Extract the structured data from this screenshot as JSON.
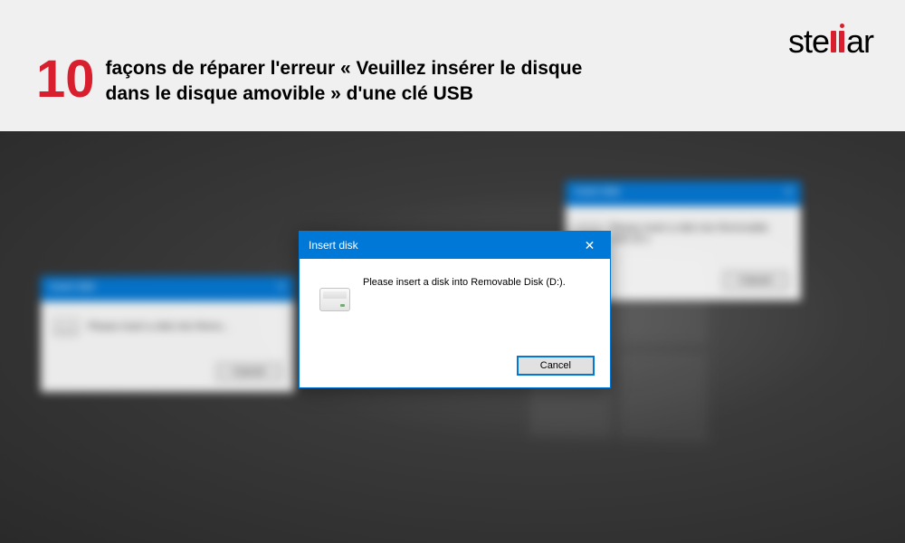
{
  "header": {
    "brand_pre": "ste",
    "brand_post": "ar",
    "number": "10",
    "title": "façons de réparer l'erreur « Veuillez insérer le disque dans le disque amovible » d'une clé USB"
  },
  "bg_dialog_left": {
    "titlebar": "Insert disk",
    "close": "X",
    "message": "Please insert a disk into Remo...",
    "button": "Cancel"
  },
  "bg_dialog_right": {
    "titlebar": "Insert disk",
    "close": "X",
    "message": "Please insert a disk into Removable Disk (D:).",
    "button": "Cancel"
  },
  "main_dialog": {
    "title": "Insert disk",
    "message": "Please insert a disk into Removable Disk (D:).",
    "cancel": "Cancel"
  }
}
